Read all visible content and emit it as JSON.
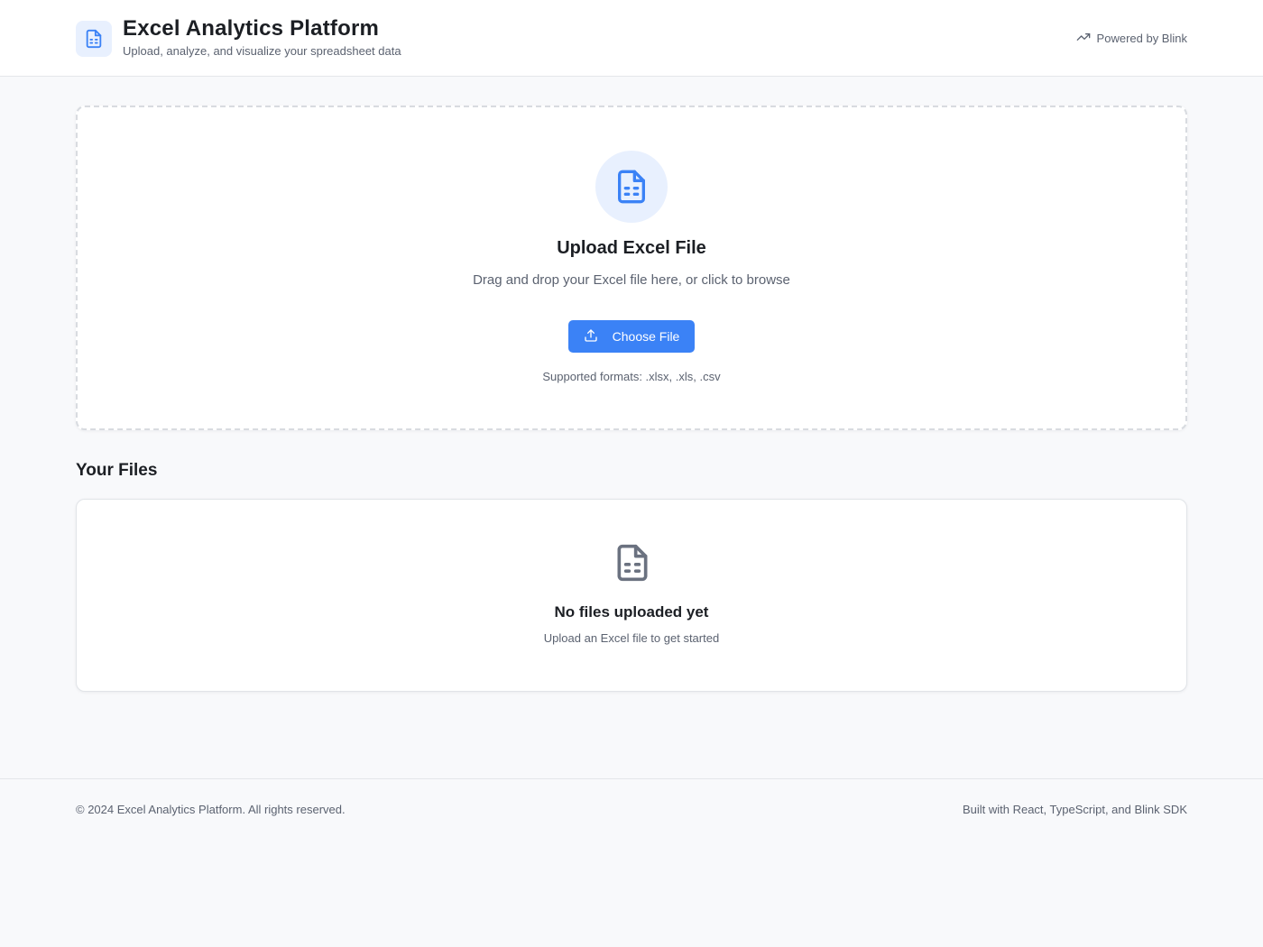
{
  "header": {
    "title": "Excel Analytics Platform",
    "subtitle": "Upload, analyze, and visualize your spreadsheet data",
    "powered_by": "Powered by Blink",
    "icons": {
      "brand": "spreadsheet-file-icon",
      "powered": "trending-up-icon"
    }
  },
  "upload": {
    "title": "Upload Excel File",
    "description": "Drag and drop your Excel file here, or click to browse",
    "button_label": "Choose File",
    "formats": "Supported formats: .xlsx, .xls, .csv",
    "icons": {
      "main": "spreadsheet-file-icon",
      "button": "upload-icon"
    }
  },
  "files": {
    "heading": "Your Files",
    "empty_title": "No files uploaded yet",
    "empty_description": "Upload an Excel file to get started",
    "icons": {
      "empty": "spreadsheet-file-icon"
    }
  },
  "footer": {
    "copyright": "© 2024 Excel Analytics Platform. All rights reserved.",
    "built_with": "Built with React, TypeScript, and Blink SDK"
  },
  "colors": {
    "accent": "#3b82f6",
    "accent_light": "#e8f0fe",
    "background": "#f8f9fb",
    "text_primary": "#1c1f24",
    "text_secondary": "#5b6270"
  }
}
